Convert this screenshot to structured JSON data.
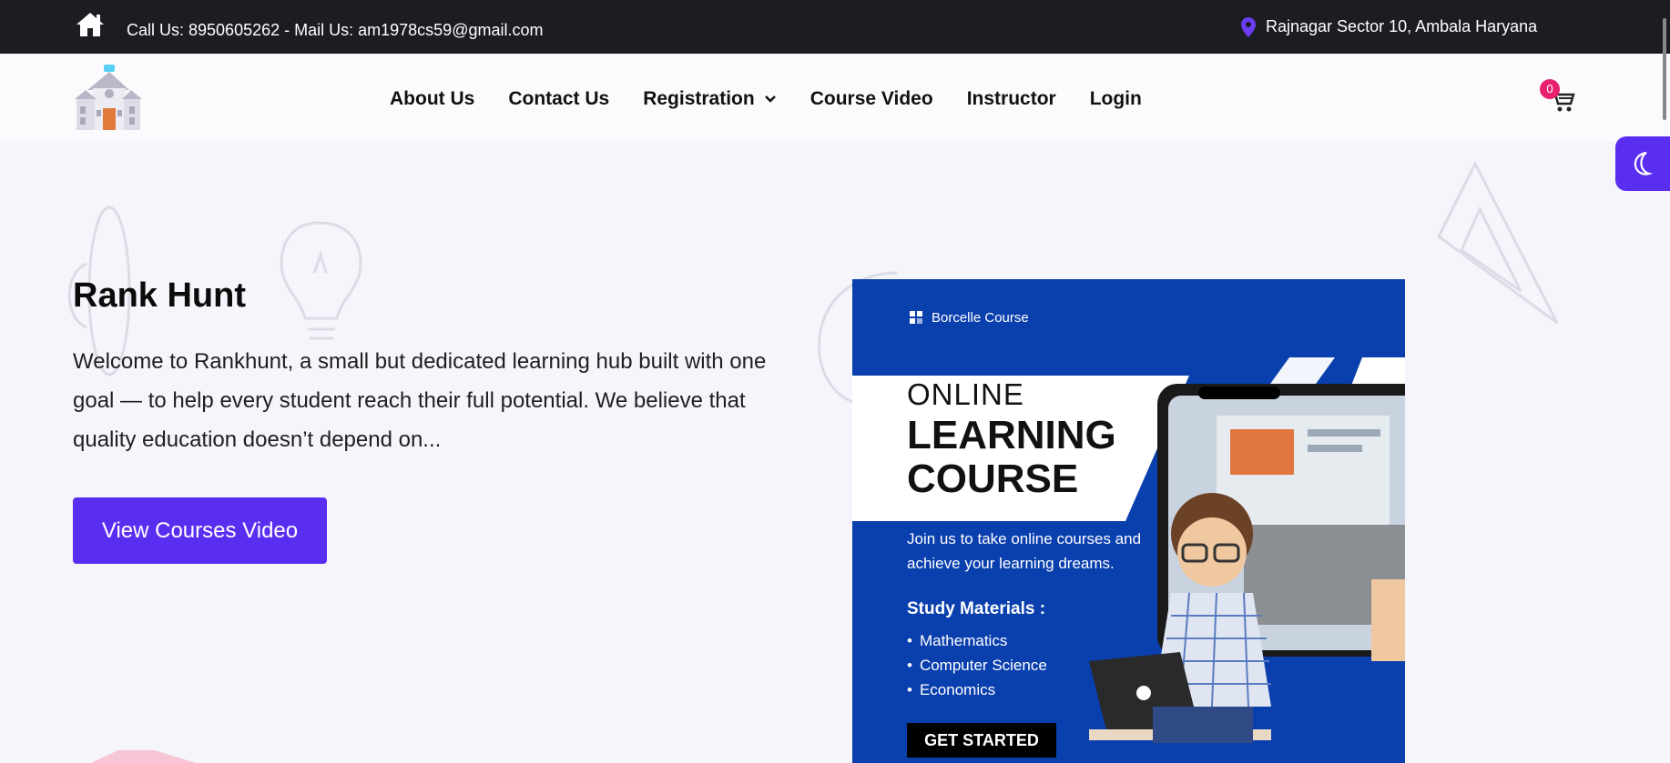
{
  "topbar": {
    "contact": "Call Us: 8950605262 - Mail Us: am1978cs59@gmail.com",
    "location": "Rajnagar Sector 10, Ambala Haryana"
  },
  "nav": {
    "items": [
      {
        "label": "About Us"
      },
      {
        "label": "Contact Us"
      },
      {
        "label": "Registration"
      },
      {
        "label": "Course Video"
      },
      {
        "label": "Instructor"
      },
      {
        "label": "Login"
      }
    ],
    "cart_count": "0"
  },
  "hero": {
    "title": "Rank Hunt",
    "text": "Welcome to Rankhunt, a small but dedicated learning hub built with one goal — to help every student reach their full potential. We believe that quality education doesn’t depend on...",
    "button": "View Courses Video"
  },
  "promo": {
    "brand": "Borcelle Course",
    "line1": "ONLINE",
    "line2": "LEARNING",
    "line3": "COURSE",
    "sub": "Join us to take online courses and achieve your learning dreams.",
    "materials_title": "Study Materials :",
    "materials": [
      "Mathematics",
      "Computer Science",
      "Economics"
    ],
    "cta": "GET STARTED"
  },
  "colors": {
    "accent": "#5a2ef0",
    "topbar": "#1c1d22",
    "badge": "#e8216f",
    "promo_blue": "#0a3fae"
  }
}
